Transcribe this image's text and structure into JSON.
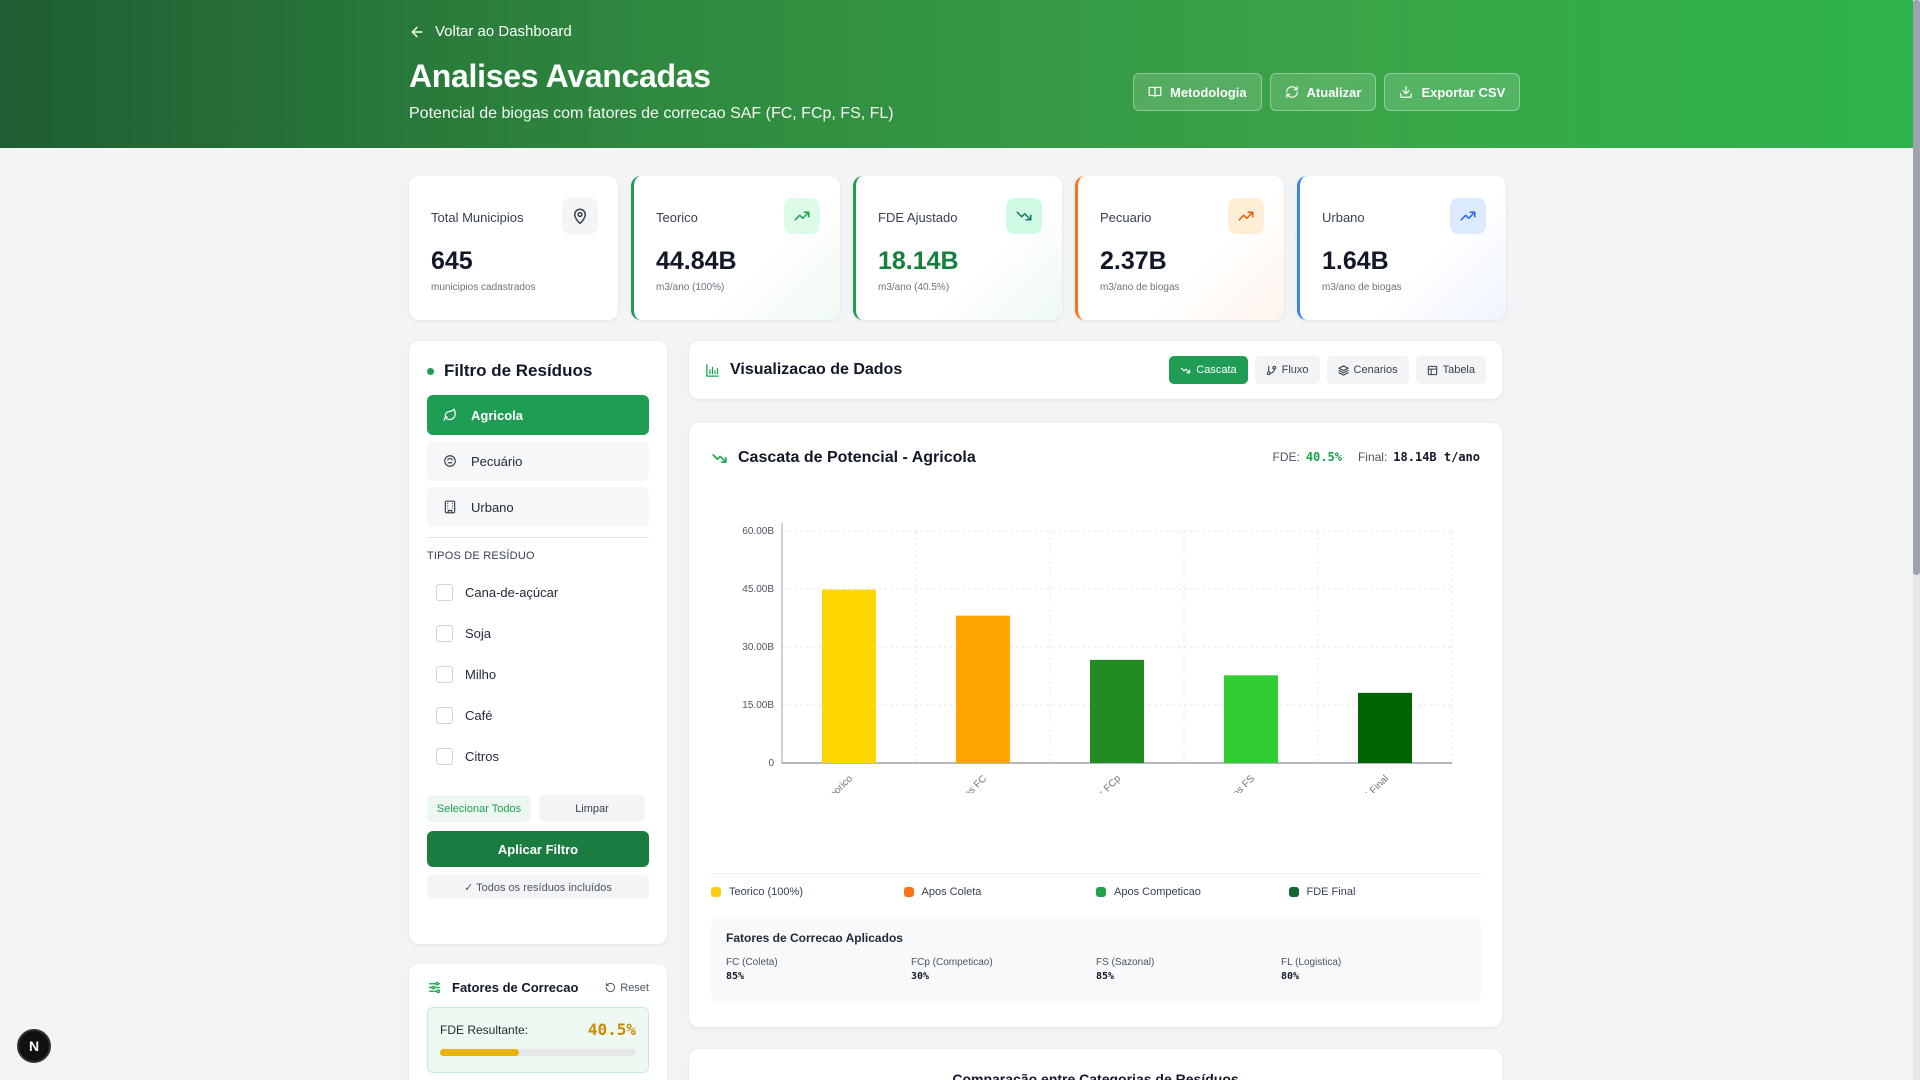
{
  "header": {
    "back_label": "Voltar ao Dashboard",
    "title": "Analises Avancadas",
    "subtitle": "Potencial de biogas com fatores de correcao SAF (FC, FCp, FS, FL)",
    "buttons": [
      {
        "label": "Metodologia",
        "icon": "book-icon"
      },
      {
        "label": "Atualizar",
        "icon": "refresh-icon"
      },
      {
        "label": "Exportar CSV",
        "icon": "download-icon"
      }
    ]
  },
  "stats": [
    {
      "label": "Total Municipios",
      "value": "645",
      "sub": "municipios cadastrados",
      "icon": "map-pin-icon"
    },
    {
      "label": "Teorico",
      "value": "44.84B",
      "sub": "m3/ano (100%)",
      "icon": "trending-up-icon"
    },
    {
      "label": "FDE Ajustado",
      "value": "18.14B",
      "sub": "m3/ano (40.5%)",
      "icon": "trending-down-icon"
    },
    {
      "label": "Pecuario",
      "value": "2.37B",
      "sub": "m3/ano de biogas",
      "icon": "trending-up-icon"
    },
    {
      "label": "Urbano",
      "value": "1.64B",
      "sub": "m3/ano de biogas",
      "icon": "trending-up-icon"
    }
  ],
  "sidebar": {
    "title": "Filtro de Resíduos",
    "categories": [
      {
        "label": "Agricola",
        "active": true
      },
      {
        "label": "Pecuário",
        "active": false
      },
      {
        "label": "Urbano",
        "active": false
      }
    ],
    "types_label": "TIPOS DE RESÍDUO",
    "types": [
      "Cana-de-açúcar",
      "Soja",
      "Milho",
      "Café",
      "Citros"
    ],
    "select_all": "Selecionar Todos",
    "clear": "Limpar",
    "apply": "Aplicar Filtro",
    "note": "✓ Todos os resíduos incluídos"
  },
  "factors_panel": {
    "title": "Fatores de Correcao",
    "reset": "Reset",
    "fde_label": "FDE Resultante:",
    "fde_value": "40.5%",
    "fde_fraction": 0.405
  },
  "viz": {
    "title": "Visualizacao de Dados",
    "tabs": [
      {
        "label": "Cascata",
        "active": true
      },
      {
        "label": "Fluxo",
        "active": false
      },
      {
        "label": "Cenarios",
        "active": false
      },
      {
        "label": "Tabela",
        "active": false
      }
    ]
  },
  "chart_card": {
    "title": "Cascata de Potencial - Agricola",
    "fde_label": "FDE:",
    "fde_value": "40.5%",
    "final_label": "Final:",
    "final_value": "18.14B t/ano",
    "legend": [
      {
        "label": "Teorico (100%)",
        "color": "#facc15"
      },
      {
        "label": "Apos Coleta",
        "color": "#f97316"
      },
      {
        "label": "Apos Competicao",
        "color": "#22a34a"
      },
      {
        "label": "FDE Final",
        "color": "#166534"
      }
    ],
    "applied_title": "Fatores de Correcao Aplicados",
    "applied": [
      {
        "label": "FC (Coleta)",
        "value": "85%"
      },
      {
        "label": "FCp (Competicao)",
        "value": "30%"
      },
      {
        "label": "FS (Sazonal)",
        "value": "85%"
      },
      {
        "label": "FL (Logistica)",
        "value": "80%"
      }
    ]
  },
  "chart_data": {
    "type": "bar",
    "categories": [
      "Teorico",
      "Apos FC",
      "Apos FCp",
      "Apos FS",
      "FDE Final"
    ],
    "values": [
      44.84,
      38.11,
      26.68,
      22.68,
      18.14
    ],
    "colors": [
      "#ffd700",
      "#ffa500",
      "#228b22",
      "#32cd32",
      "#006400"
    ],
    "unit": "B",
    "yticks": [
      "0",
      "15.00B",
      "30.00B",
      "45.00B",
      "60.00B"
    ],
    "ylim": [
      0,
      60
    ],
    "grid": true
  },
  "compare": {
    "title": "Comparação entre Categorias de Resíduos"
  },
  "badge": {
    "label": "N"
  }
}
